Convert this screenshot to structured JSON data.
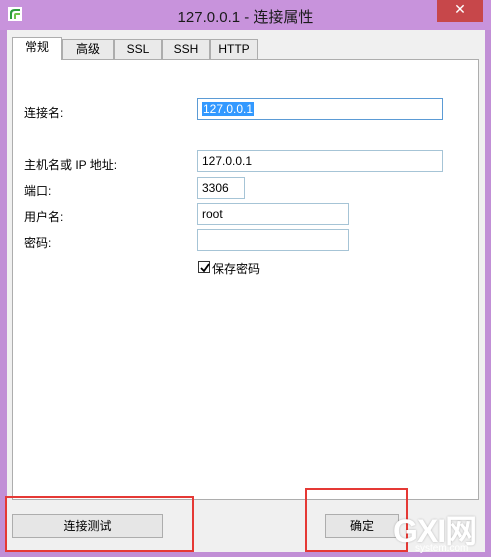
{
  "window": {
    "title": "127.0.0.1 - 连接属性",
    "close_label": "✕"
  },
  "tabs": [
    {
      "label": "常规",
      "active": true
    },
    {
      "label": "高级",
      "active": false
    },
    {
      "label": "SSL",
      "active": false
    },
    {
      "label": "SSH",
      "active": false
    },
    {
      "label": "HTTP",
      "active": false
    }
  ],
  "form": {
    "connection_name_label": "连接名:",
    "connection_name_value": "127.0.0.1",
    "host_label": "主机名或 IP 地址:",
    "host_value": "127.0.0.1",
    "port_label": "端口:",
    "port_value": "3306",
    "user_label": "用户名:",
    "user_value": "root",
    "password_label": "密码:",
    "password_value": "",
    "save_password_label": "保存密码",
    "save_password_checked": true
  },
  "buttons": {
    "test_connection": "连接测试",
    "ok": "确定"
  },
  "watermark": {
    "main": "GXI网",
    "sub": "system.com"
  },
  "colors": {
    "title_bar": "#c893dc",
    "close_button": "#c7474a",
    "highlight": "#e53935",
    "selection": "#3399ff"
  }
}
